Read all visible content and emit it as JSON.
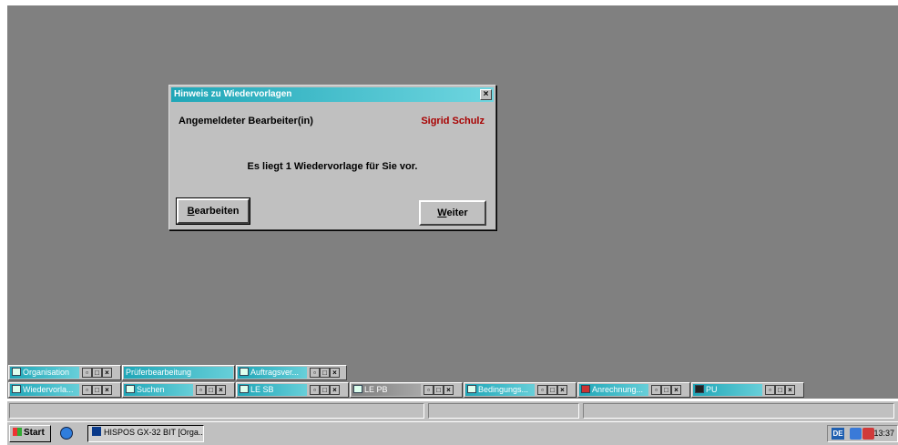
{
  "dialog": {
    "title": "Hinweis zu Wiedervorlagen",
    "close": "×",
    "user_label": "Angemeldeter Bearbeiter(in)",
    "user_value": "Sigrid Schulz",
    "message": "Es liegt 1 Wiedervorlage für Sie vor.",
    "edit_button_first": "B",
    "edit_button_rest": "earbeiten",
    "next_button_first": "W",
    "next_button_rest": "eiter"
  },
  "minimized_row1": [
    {
      "label": "Organisation"
    },
    {
      "label": "Prüferbearbeitung"
    },
    {
      "label": "Auftragsver..."
    }
  ],
  "minimized_row2": [
    {
      "label": "Wiedervorla..."
    },
    {
      "label": "Suchen"
    },
    {
      "label": "LE SB"
    },
    {
      "label": "LE PB"
    },
    {
      "label": "Bedingungs..."
    },
    {
      "label": "Anrechnung..."
    },
    {
      "label": "PU"
    }
  ],
  "controls": {
    "restore": "▫",
    "maximize": "□",
    "close": "×"
  },
  "taskbar": {
    "start": "Start",
    "app_task": "HISPOS GX-32 BIT [Orga...",
    "tray_lang": "DE",
    "clock": "13:37"
  },
  "colors": {
    "desktop": "#808080",
    "title_gradient_start": "#1fa6b7",
    "title_gradient_end": "#6fd6e0",
    "user_value": "#a80000"
  }
}
